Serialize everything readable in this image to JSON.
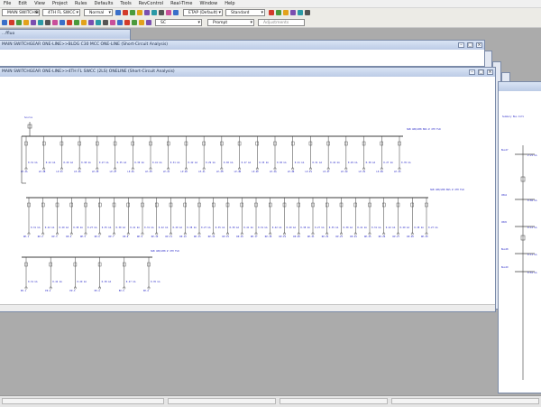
{
  "menu": [
    "File",
    "Edit",
    "View",
    "Project",
    "Rules",
    "Defaults",
    "Tools",
    "RevControl",
    "Real-Time",
    "Window",
    "Help"
  ],
  "toolbar": {
    "presentation": "MAIN SWITCHGE",
    "oneline": "4TH FL SWCC",
    "config": "Normal",
    "revision_data": "ETAP (Default)",
    "standard": "Standard",
    "study_mode": "SC",
    "project_status": "Prompt",
    "adjustments": "Adjustments"
  },
  "windows": {
    "back_title": "MAIN SWITCHGEAR ONE-LINE>>BLDG C30 MCC ONE-LINE (Short-Circuit Analysis)",
    "front_title": "MAIN SWITCHGEAR ONE-LINE>>4TH FL SWCC (2LS) ONELINE (Short-Circuit Analysis)",
    "tiny_title": "...ffluo"
  },
  "oneline": {
    "source_label": "Source",
    "bus1_note": "SUB 480/208 BUS # 4TH FLR",
    "bus2_note": "SUB 480/208 BUS # 4TH FLR",
    "bus3_note": "SUB 480/208 # 4TH FLR",
    "right_note": "Summary Bus Info",
    "right_bus_labels": [
      "Bus27",
      "CB44",
      "CB45",
      "Bus28",
      "Bus29"
    ],
    "right_values": [
      "2.21 kA",
      "0.84 kA",
      "0.12 kA",
      "0.11 kA",
      "0.61 kA"
    ],
    "row1_labels": [
      "LP-4A",
      "LP-4B",
      "LP-4C",
      "LP-4D",
      "LP-4E",
      "LP-4F",
      "LP-4G",
      "LP-4H",
      "LP-4J",
      "LP-4K",
      "LP-4L",
      "LP-4M",
      "LP-4N",
      "LP-4P",
      "LP-4Q",
      "LP-4R",
      "LP-4S",
      "LP-4T",
      "LP-4U",
      "LP-4V",
      "LP-4W",
      "LP-4X"
    ],
    "row2_labels": [
      "RP-1",
      "RP-2",
      "RP-3",
      "RP-4",
      "RP-5",
      "RP-6",
      "RP-7",
      "RP-8",
      "RP-9",
      "RP-10",
      "RP-11",
      "RP-12",
      "RP-13",
      "RP-14",
      "RP-15",
      "RP-16",
      "RP-17",
      "RP-18",
      "RP-19",
      "RP-20",
      "RP-21",
      "RP-22",
      "RP-23",
      "RP-24",
      "RP-25",
      "RP-26",
      "RP-27",
      "RP-28",
      "RP-29"
    ],
    "row3_labels": [
      "EP-1",
      "EP-2",
      "EP-3",
      "EP-4",
      "EP-5",
      "EP-6"
    ],
    "fault_values": [
      "0.31 kA",
      "0.42 kA",
      "0.29 kA",
      "0.38 kA",
      "0.27 kA",
      "0.35 kA",
      "0.30 kA",
      "0.41 kA"
    ]
  }
}
